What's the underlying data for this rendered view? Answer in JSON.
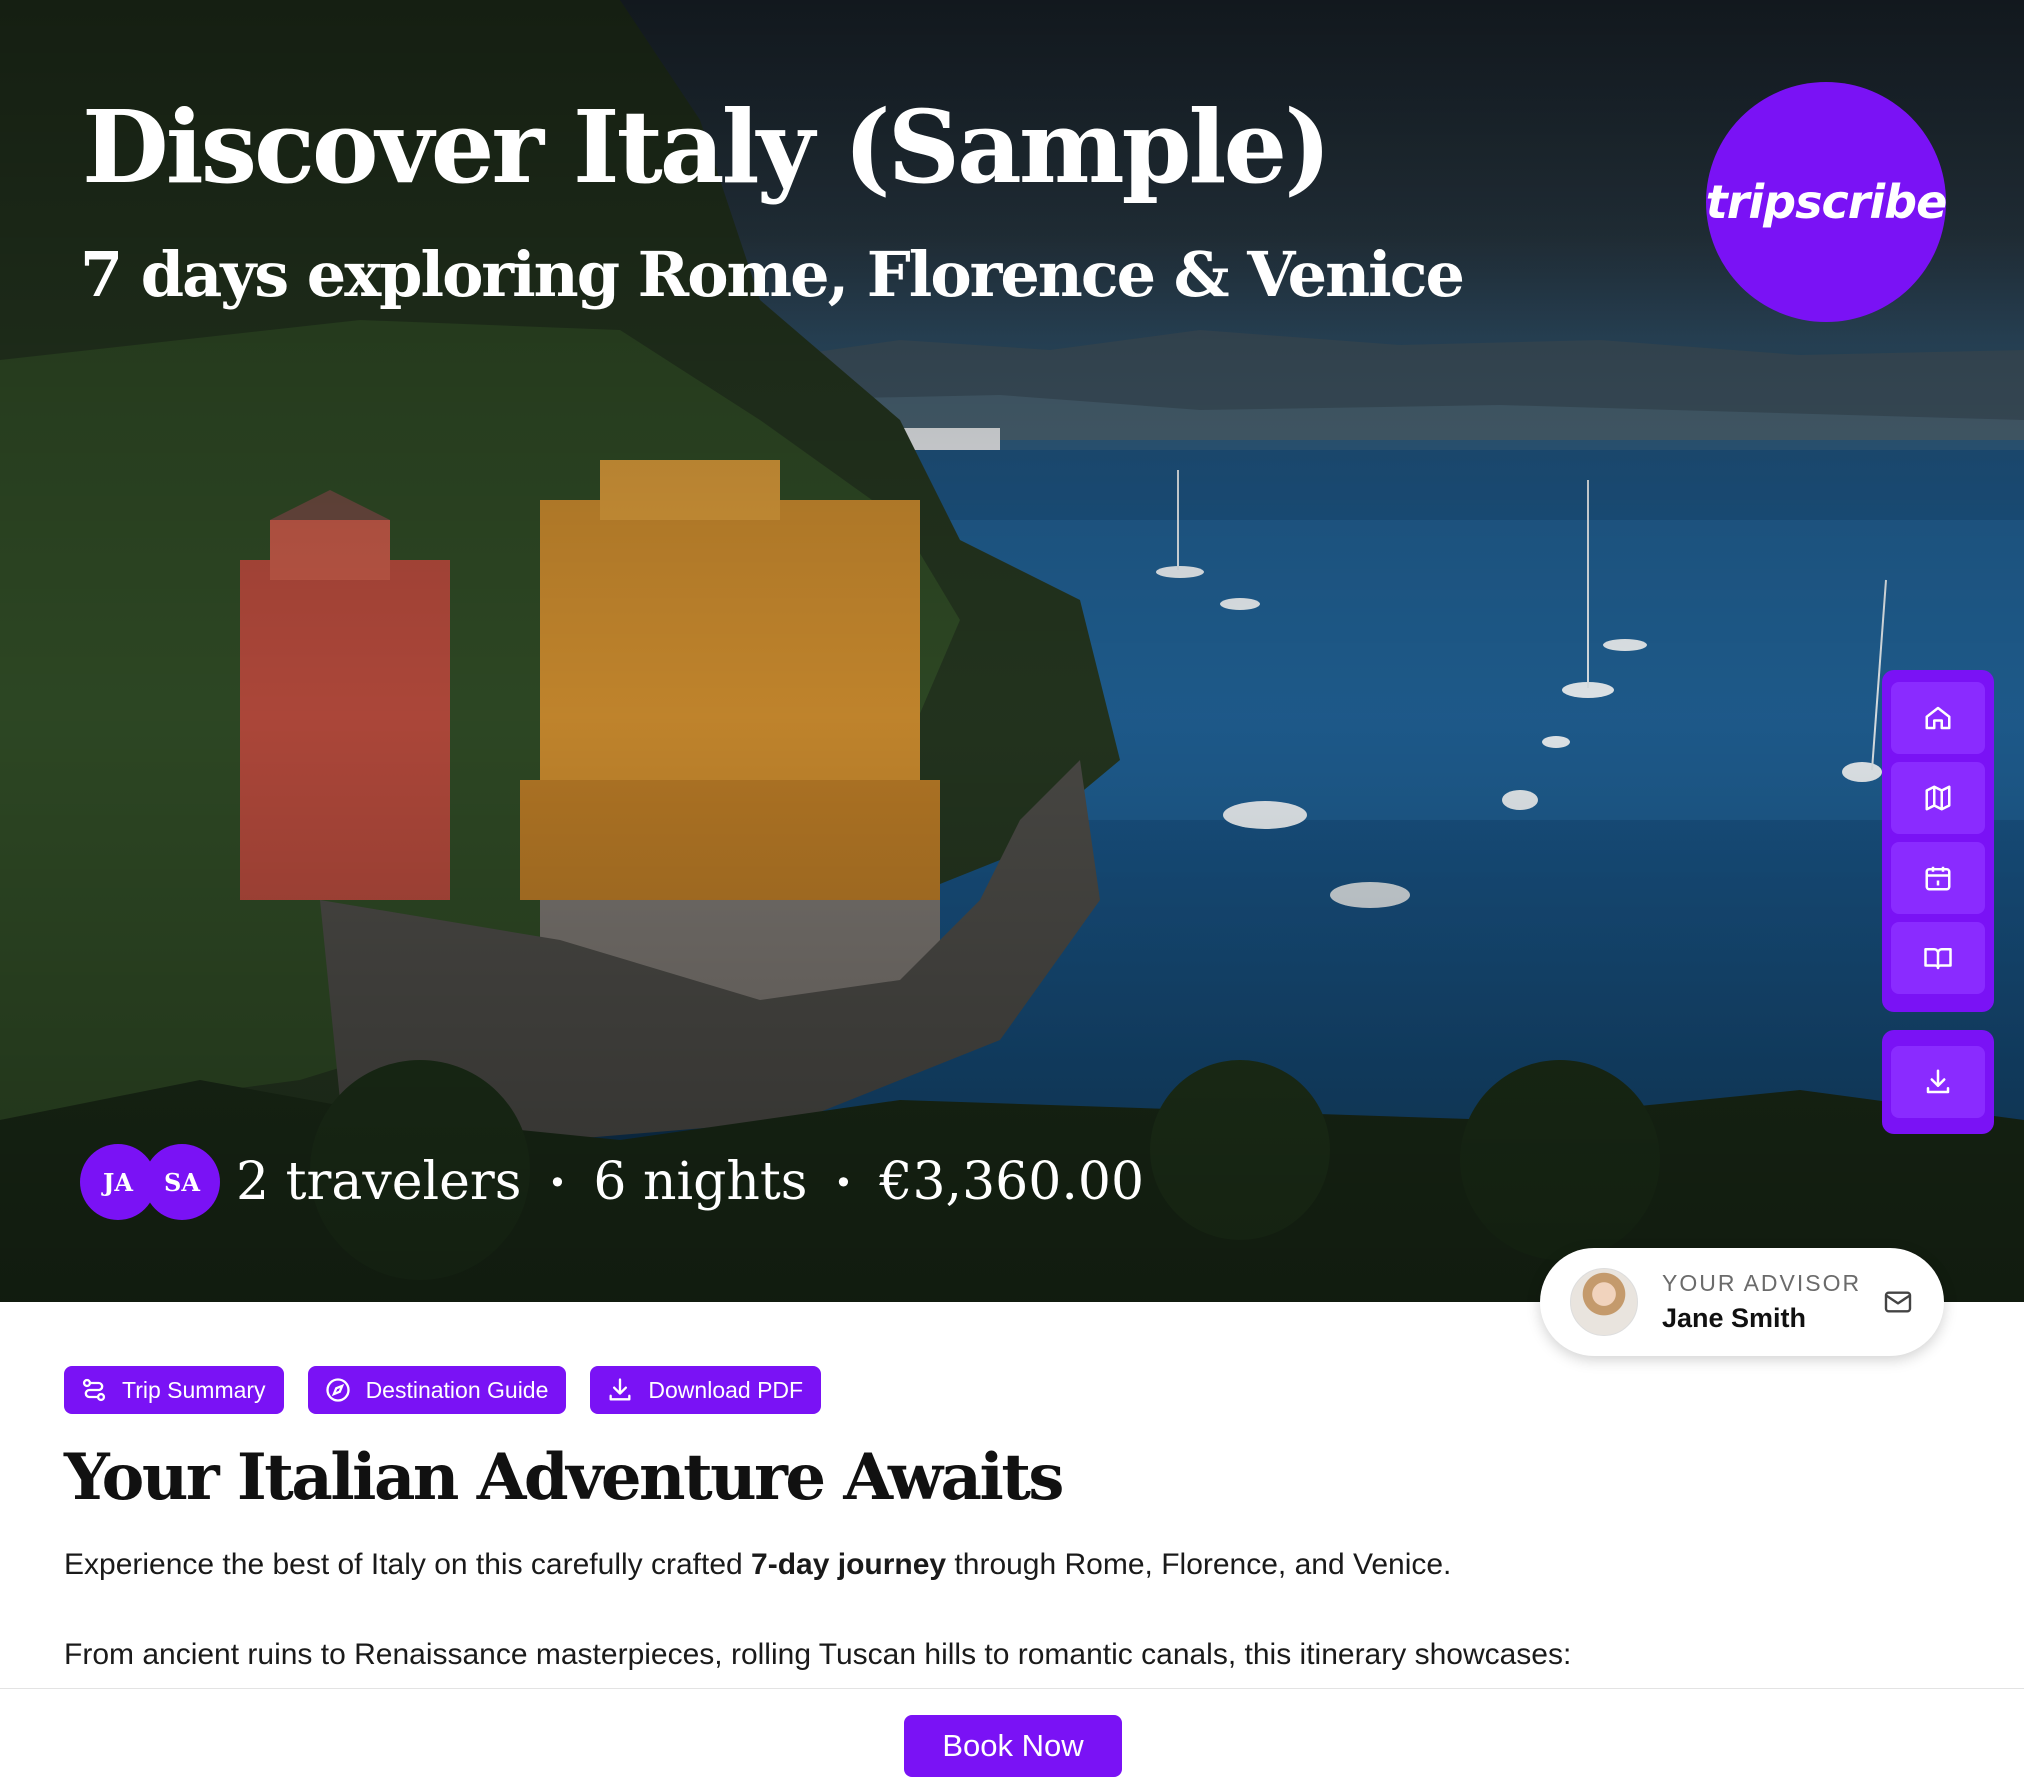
{
  "hero": {
    "title": "Discover Italy (Sample)",
    "subtitle": "7 days exploring Rome, Florence & Venice",
    "brand": "tripscribe",
    "travelers": [
      {
        "initials": "JA"
      },
      {
        "initials": "SA"
      }
    ],
    "meta": {
      "travelers": "2 travelers",
      "nights": "6 nights",
      "price": "€3,360.00",
      "separator": "•"
    },
    "side_nav": [
      "home-icon",
      "map-icon",
      "calendar-icon",
      "book-open-icon"
    ],
    "download_icon": "download-icon"
  },
  "advisor": {
    "label": "YOUR ADVISOR",
    "name": "Jane Smith",
    "contact_icon": "mail-icon"
  },
  "actions": {
    "trip_summary": "Trip Summary",
    "destination_guide": "Destination Guide",
    "download_pdf": "Download PDF"
  },
  "content": {
    "heading": "Your Italian Adventure Awaits",
    "para1_before": "Experience the best of Italy on this carefully crafted ",
    "para1_bold": "7-day journey",
    "para1_after": " through Rome, Florence, and Venice.",
    "para2": "From ancient ruins to Renaissance masterpieces, rolling Tuscan hills to romantic canals, this itinerary showcases:"
  },
  "footer": {
    "book_label": "Book Now"
  },
  "colors": {
    "brand": "#7a12f5"
  }
}
